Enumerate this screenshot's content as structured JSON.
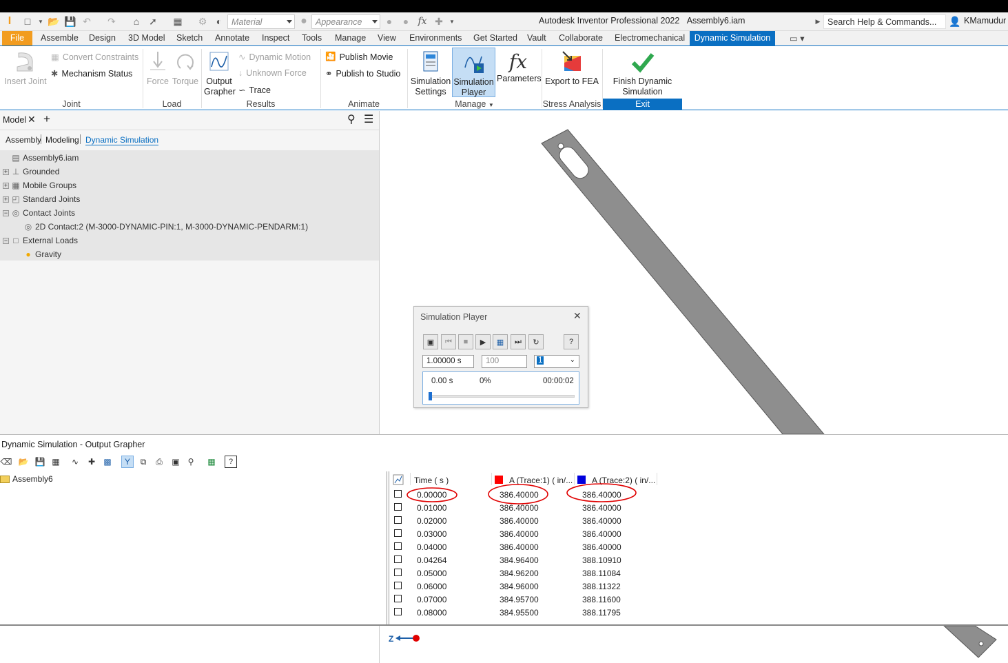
{
  "window": {
    "title": "Autodesk Inventor Professional 2022",
    "document": "Assembly6.iam",
    "search_placeholder": "Search Help & Commands...",
    "user": "KMamudur",
    "material": "Material",
    "appearance": "Appearance",
    "fx": "fx"
  },
  "tabs": [
    "File",
    "Assemble",
    "Design",
    "3D Model",
    "Sketch",
    "Annotate",
    "Inspect",
    "Tools",
    "Manage",
    "View",
    "Environments",
    "Get Started",
    "Vault",
    "Collaborate",
    "Electromechanical",
    "Dynamic Simulation"
  ],
  "ribbon": {
    "joint": {
      "label": "Joint",
      "insert_joint": "Insert Joint",
      "convert_constraints": "Convert Constraints",
      "mechanism_status": "Mechanism Status"
    },
    "load": {
      "label": "Load",
      "force": "Force",
      "torque": "Torque"
    },
    "results": {
      "label": "Results",
      "output_grapher": "Output Grapher",
      "dynamic_motion": "Dynamic Motion",
      "unknown_force": "Unknown Force",
      "trace": "Trace"
    },
    "animate": {
      "label": "Animate",
      "publish_movie": "Publish Movie",
      "publish_studio": "Publish to Studio"
    },
    "manage": {
      "label": "Manage",
      "sim_settings": "Simulation Settings",
      "sim_player": "Simulation Player",
      "parameters": "Parameters"
    },
    "stress": {
      "label": "Stress Analysis",
      "export_fea": "Export to FEA"
    },
    "exit": {
      "label": "Exit",
      "finish": "Finish Dynamic Simulation"
    }
  },
  "browser": {
    "title": "Model",
    "views": [
      "Assembly",
      "Modeling",
      "Dynamic Simulation"
    ],
    "tree": [
      {
        "label": "Assembly6.iam",
        "indent": 0,
        "toggle": ""
      },
      {
        "label": "Grounded",
        "indent": 0,
        "toggle": "+"
      },
      {
        "label": "Mobile Groups",
        "indent": 0,
        "toggle": "+"
      },
      {
        "label": "Standard Joints",
        "indent": 0,
        "toggle": "+"
      },
      {
        "label": "Contact Joints",
        "indent": 0,
        "toggle": "−"
      },
      {
        "label": "2D Contact:2 (M-3000-DYNAMIC-PIN:1, M-3000-DYNAMIC-PENDARM:1)",
        "indent": 1,
        "toggle": ""
      },
      {
        "label": "External Loads",
        "indent": 0,
        "toggle": "−"
      },
      {
        "label": "Gravity",
        "indent": 1,
        "toggle": ""
      }
    ]
  },
  "player": {
    "title": "Simulation Player",
    "final_time": "1.00000 s",
    "images": "100",
    "filter": "1",
    "current_time": "0.00 s",
    "percent": "0%",
    "elapsed": "00:00:02",
    "progress": 0
  },
  "grapher": {
    "title": "Dynamic Simulation - Output Grapher",
    "tree_root": "Assembly6",
    "columns": [
      "Time ( s )",
      "A (Trace:1) ( in/...",
      "A (Trace:2) ( in/..."
    ],
    "column_colors": [
      "#ff0000",
      "#0000dd"
    ],
    "rows": [
      [
        "0.00000",
        "386.40000",
        "386.40000"
      ],
      [
        "0.01000",
        "386.40000",
        "386.40000"
      ],
      [
        "0.02000",
        "386.40000",
        "386.40000"
      ],
      [
        "0.03000",
        "386.40000",
        "386.40000"
      ],
      [
        "0.04000",
        "386.40000",
        "386.40000"
      ],
      [
        "0.04264",
        "384.96400",
        "388.10910"
      ],
      [
        "0.05000",
        "384.96200",
        "388.11084"
      ],
      [
        "0.06000",
        "384.96000",
        "388.11322"
      ],
      [
        "0.07000",
        "384.95700",
        "388.11600"
      ],
      [
        "0.08000",
        "384.95500",
        "388.11795"
      ]
    ]
  },
  "triad": {
    "axis": "Z"
  }
}
